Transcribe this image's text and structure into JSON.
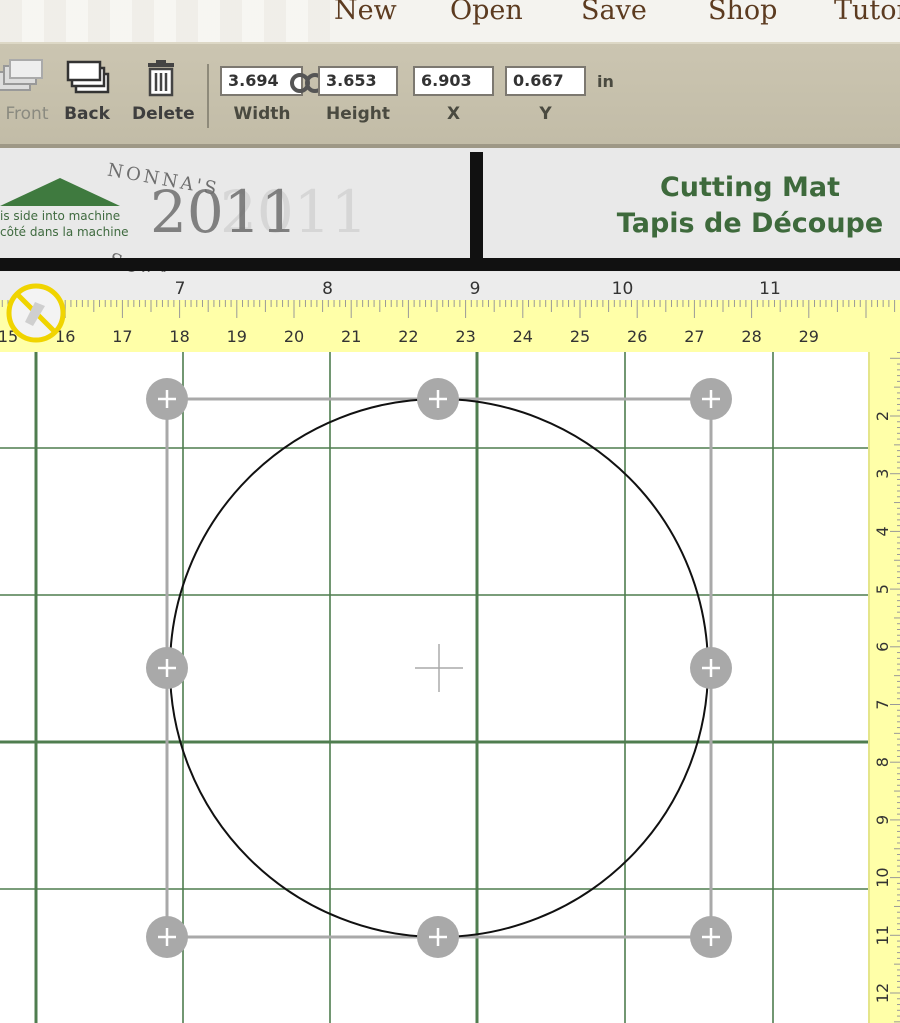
{
  "menu": {
    "items": [
      {
        "id": "new",
        "label": "New"
      },
      {
        "id": "open",
        "label": "Open"
      },
      {
        "id": "save",
        "label": "Save"
      },
      {
        "id": "shop",
        "label": "Shop"
      },
      {
        "id": "tutorials",
        "label": "Tutor"
      }
    ]
  },
  "toolbar": {
    "front_label": "Front",
    "back_label": "Back",
    "delete_label": "Delete",
    "width_value": "3.694",
    "height_value": "3.653",
    "x_value": "6.903",
    "y_value": "0.667",
    "width_label": "Width",
    "height_label": "Height",
    "x_label": "X",
    "y_label": "Y",
    "unit": "in"
  },
  "banner": {
    "insert_line1": "is side into machine",
    "insert_line2": "côté dans la machine",
    "watermark_top": "NONNA'S",
    "watermark_year": "2011",
    "watermark_bottom": "SCRAPS",
    "mat_title_en": "Cutting Mat",
    "mat_title_fr": "Tapis de Découpe"
  },
  "rulers": {
    "inch_labels": [
      "7",
      "8",
      "9",
      "10",
      "11"
    ],
    "cm_labels": [
      "15",
      "16",
      "17",
      "18",
      "19",
      "20",
      "21",
      "22",
      "23",
      "24",
      "25",
      "26",
      "27",
      "28",
      "29"
    ],
    "vertical_labels": [
      "2",
      "3",
      "4",
      "5",
      "6",
      "7",
      "8",
      "9",
      "10",
      "11",
      "12"
    ]
  },
  "colors": {
    "grid_green": "#4f7d4f",
    "ruler_yellow": "#ffffa8",
    "brand_green": "#3e6a3c",
    "menu_brown": "#5c3b20",
    "handle_gray": "#a9a9a9"
  },
  "icons": {
    "front": "bring-to-front-icon",
    "back": "send-to-back-icon",
    "delete": "trash-icon",
    "link": "link-aspect-icon",
    "no_entry": "no-entry-icon",
    "handle_tl": "move-arrows-icon",
    "handle_tc": "resize-vertical-icon",
    "handle_tr": "resize-diagonal-icon",
    "handle_ml": "resize-horizontal-icon",
    "handle_mr": "resize-horizontal-icon",
    "handle_bl": "rotate-icon",
    "handle_bc": "resize-vertical-icon",
    "handle_br": "resize-diagonal-icon"
  }
}
